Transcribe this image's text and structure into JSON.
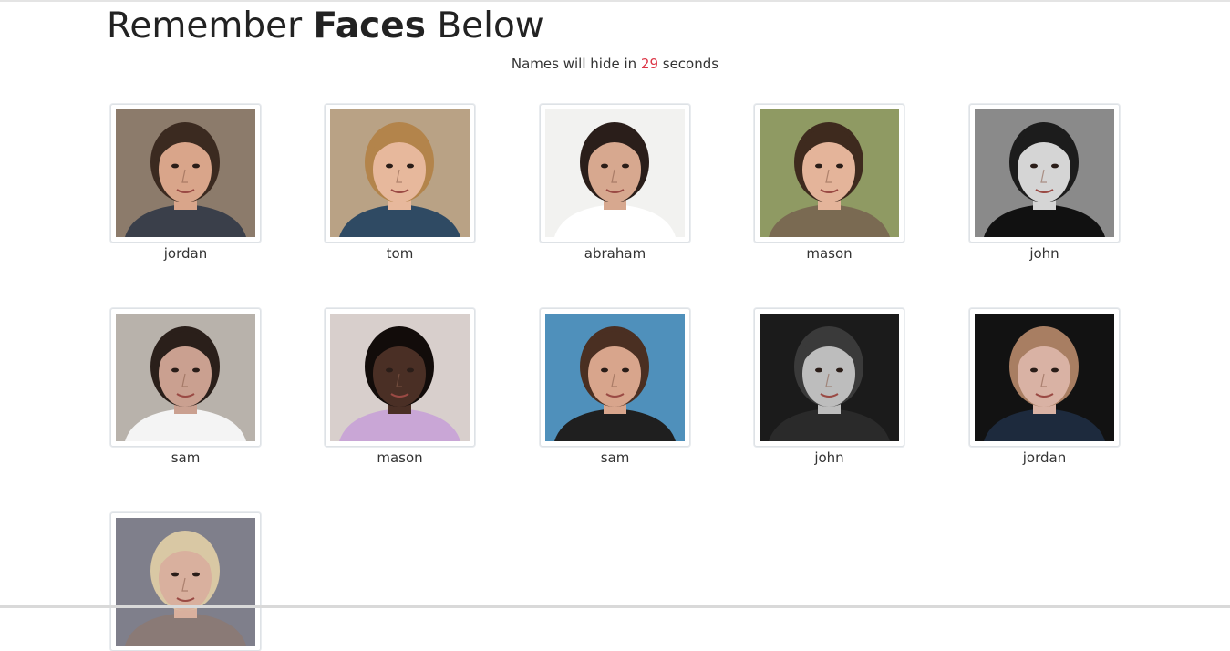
{
  "header": {
    "title_part1": "Remember ",
    "title_bold": "Faces",
    "title_part3": " Below",
    "timer_prefix": "Names will hide in ",
    "timer_value": "29",
    "timer_suffix": " seconds"
  },
  "faces": [
    {
      "name": "jordan",
      "bg": "#8c7b6b",
      "skin": "#d9a58a",
      "hair": "#3b2a20",
      "shirt": "#3a3f4a"
    },
    {
      "name": "tom",
      "bg": "#b9a285",
      "skin": "#e7b89c",
      "hair": "#b3844b",
      "shirt": "#2f4a63"
    },
    {
      "name": "abraham",
      "bg": "#f2f2f0",
      "skin": "#d7a88f",
      "hair": "#2a1e1a",
      "shirt": "#ffffff"
    },
    {
      "name": "mason",
      "bg": "#8f9a63",
      "skin": "#e4b49a",
      "hair": "#3e2a1e",
      "shirt": "#7a6a52"
    },
    {
      "name": "john",
      "bg": "#8a8a8a",
      "skin": "#d5d5d5",
      "hair": "#1c1c1c",
      "shirt": "#111111"
    },
    {
      "name": "sam",
      "bg": "#b8b2ab",
      "skin": "#caa090",
      "hair": "#2a1f1a",
      "shirt": "#f4f4f4"
    },
    {
      "name": "mason",
      "bg": "#d8cfcc",
      "skin": "#4a2f25",
      "hair": "#120c0a",
      "shirt": "#c9a6d6"
    },
    {
      "name": "sam",
      "bg": "#4f90bb",
      "skin": "#d8a58c",
      "hair": "#4a2f22",
      "shirt": "#1f1f1f"
    },
    {
      "name": "john",
      "bg": "#1b1b1b",
      "skin": "#bdbdbd",
      "hair": "#3a3a3a",
      "shirt": "#2a2a2a"
    },
    {
      "name": "jordan",
      "bg": "#121212",
      "skin": "#d9b2a4",
      "hair": "#a87e62",
      "shirt": "#1d2a3d"
    },
    {
      "name": "",
      "bg": "#7f7f8b",
      "skin": "#d9b09e",
      "hair": "#d9c8a4",
      "shirt": "#8a7a76"
    }
  ]
}
